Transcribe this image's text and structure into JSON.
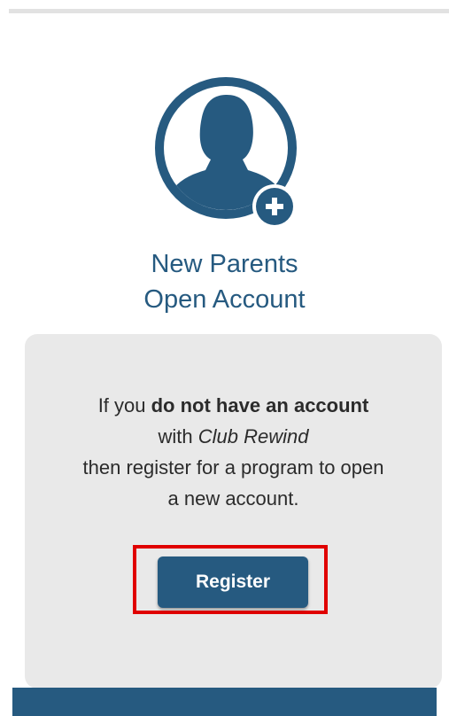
{
  "colors": {
    "brand": "#265a80",
    "panel_bg": "#e9e9e9",
    "highlight": "#e00000",
    "text": "#2b2b2b"
  },
  "card": {
    "icon": "add-user-icon",
    "title_line1": "New Parents",
    "title_line2": "Open Account"
  },
  "info": {
    "line1_pre": "If you ",
    "line1_bold": "do not have an account",
    "line2_pre": "with ",
    "line2_italic": "Club Rewind",
    "line3": "then register for a program to open",
    "line4": "a new account."
  },
  "register_button": {
    "label": "Register"
  }
}
